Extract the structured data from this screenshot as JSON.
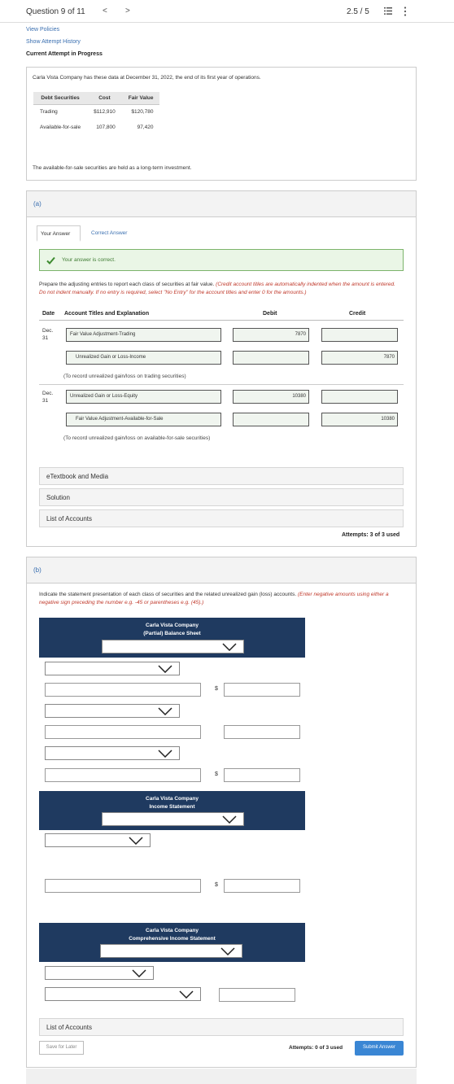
{
  "header": {
    "question": "Question 9 of 11",
    "prev": "<",
    "next": ">",
    "score": "2.5 / 5"
  },
  "links": {
    "view_policies": "View Policies",
    "attempt_history": "Show Attempt History",
    "current_attempt": "Current Attempt in Progress"
  },
  "intro": {
    "text": "Carla Vista Company has these data at December 31, 2022, the end of its first year of operations.",
    "columns": [
      "Debt Securities",
      "Cost",
      "Fair Value"
    ],
    "rows": [
      [
        "Trading",
        "$112,910",
        "$120,780"
      ],
      [
        "Available-for-sale",
        "107,800",
        "97,420"
      ]
    ],
    "held_text": "The available-for-sale securities are held as a long-term investment."
  },
  "part_a": {
    "letter": "(a)",
    "tab_yours": "Your Answer",
    "tab_correct": "Correct Answer",
    "correct_msg": "Your answer is correct.",
    "instr_plain": "Prepare the adjusting entries to report each class of securities at fair value.",
    "instr_red": "(Credit account titles are automatically indented when the amount is entered. Do not indent manually. If no entry is required, select \"No Entry\" for the account titles and enter 0 for the amounts.)",
    "col_date": "Date",
    "col_account": "Account Titles and Explanation",
    "col_debit": "Debit",
    "col_credit": "Credit",
    "entries": [
      {
        "date": "Dec.\n31",
        "line1_account": "Fair Value Adjustment-Trading",
        "line1_debit": "7870",
        "line2_account": "Unrealized Gain or Loss-Income",
        "line2_credit": "7870",
        "note": "(To record unrealized gain/loss on trading securities)"
      },
      {
        "date": "Dec.\n31",
        "line1_account": "Unrealized Gain or Loss-Equity",
        "line1_debit": "10380",
        "line2_account": "Fair Value Adjustment-Available-for-Sale",
        "line2_credit": "10380",
        "note": "(To record unrealized gain/loss on available-for-sale securities)"
      }
    ],
    "etextbook": "eTextbook and Media",
    "solution": "Solution",
    "list_accounts": "List of Accounts",
    "attempts": "Attempts: 3 of 3 used"
  },
  "part_b": {
    "letter": "(b)",
    "instr_plain": "Indicate the statement presentation of each class of securities and the related unrealized gain (loss) accounts.",
    "instr_red": "(Enter negative amounts using either a negative sign preceding the number e.g. -45 or parentheses e.g. (45).)",
    "bs_company": "Carla Vista Company",
    "bs_title": "(Partial) Balance Sheet",
    "is_company": "Carla Vista Company",
    "is_title": "Income Statement",
    "ci_company": "Carla Vista Company",
    "ci_title": "Comprehensive Income Statement",
    "dollar": "$",
    "list_accounts": "List of Accounts",
    "save_later": "Save for Later",
    "attempts": "Attempts: 0 of 3 used",
    "submit": "Submit Answer"
  }
}
